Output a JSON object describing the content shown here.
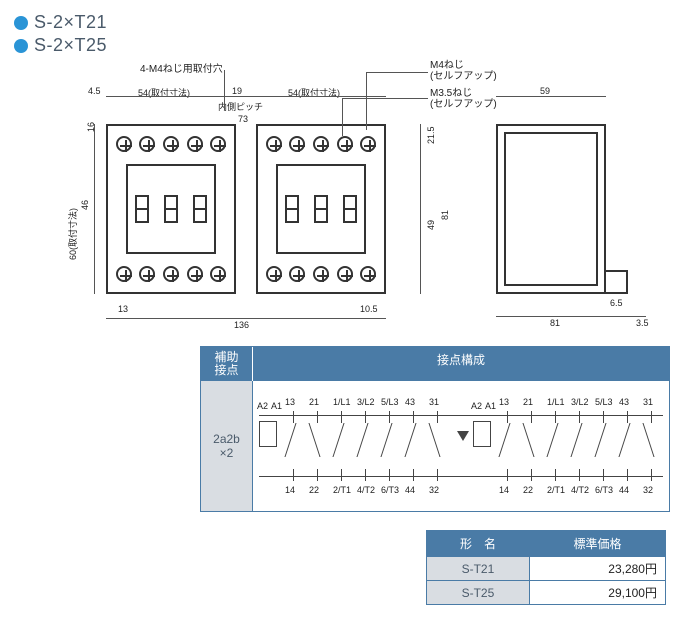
{
  "titles": [
    "S-2×T21",
    "S-2×T25"
  ],
  "drawing": {
    "callouts": {
      "mounting_holes": "4-M4ねじ用取付穴",
      "m4_screw": "M4ねじ\n(セルフアップ)",
      "m35_screw": "M3.5ねじ\n(セルフアップ)"
    },
    "dims": {
      "left_margin": "4.5",
      "mount_w": "54(取付寸法)",
      "inner_pitch_label": "内側ピッチ",
      "inner_pitch_gap": "19",
      "inner_pitch": "73",
      "mount_w2": "54(取付寸法)",
      "overall_w": "136",
      "bottom_left_gap": "13",
      "bottom_right_gap": "10.5",
      "top_offset": "16",
      "body_h": "46",
      "mount_h": "60(取付寸法)",
      "side_offset": "21.5",
      "side_inner_h": "49",
      "side_outer_h": "81",
      "side_top_w": "59",
      "side_bottom_w": "81",
      "side_step": "6.5",
      "side_right_margin": "3.5"
    }
  },
  "contact_table": {
    "header_aux": "補助\n接点",
    "header_config": "接点構成",
    "aux_value": "2a2b\n×2",
    "terminals_upper": [
      "A2",
      "A1",
      "13",
      "21",
      "1/L1",
      "3/L2",
      "5/L3",
      "43",
      "31"
    ],
    "terminals_lower": [
      "14",
      "22",
      "2/T1",
      "4/T2",
      "6/T3",
      "44",
      "32"
    ]
  },
  "price_table": {
    "headers": {
      "model": "形　名",
      "price": "標準価格"
    },
    "rows": [
      {
        "model": "S-T21",
        "price": "23,280円"
      },
      {
        "model": "S-T25",
        "price": "29,100円"
      }
    ]
  }
}
